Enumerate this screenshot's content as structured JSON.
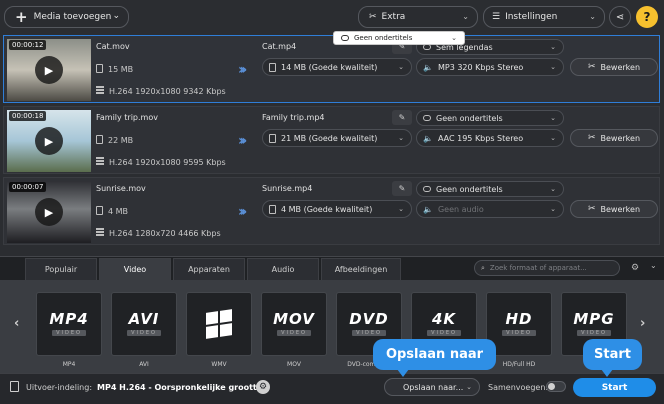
{
  "toolbar": {
    "add_media_label": "Media toevoegen",
    "extra_label": "Extra",
    "settings_label": "Instellingen",
    "help_label": "?"
  },
  "subtitle_tooltip": "Geen ondertitels",
  "files": [
    {
      "duration": "00:00:12",
      "name": "Cat.mov",
      "size": "15 MB",
      "codec": "H.264 1920x1080 9342 Kbps",
      "output_name": "Cat.mp4",
      "output_size": "14 MB (Goede kwaliteit)",
      "subtitles": "Sem legendas",
      "audio": "MP3 320 Kbps Stereo",
      "edit_label": "Bewerken"
    },
    {
      "duration": "00:00:18",
      "name": "Family trip.mov",
      "size": "22 MB",
      "codec": "H.264 1920x1080 9595 Kbps",
      "output_name": "Family trip.mp4",
      "output_size": "21 MB (Goede kwaliteit)",
      "subtitles": "Geen ondertitels",
      "audio": "AAC 195 Kbps Stereo",
      "edit_label": "Bewerken"
    },
    {
      "duration": "00:00:07",
      "name": "Sunrise.mov",
      "size": "4 MB",
      "codec": "H.264 1280x720 4466 Kbps",
      "output_name": "Sunrise.mp4",
      "output_size": "4 MB (Goede kwaliteit)",
      "subtitles": "Geen ondertitels",
      "audio": "Geen audio",
      "edit_label": "Bewerken"
    }
  ],
  "tabs": [
    "Populair",
    "Video",
    "Apparaten",
    "Audio",
    "Afbeeldingen"
  ],
  "active_tab": "Video",
  "format_search_placeholder": "Zoek formaat of apparaat...",
  "formats": [
    {
      "badge": "MP4",
      "label": "MP4"
    },
    {
      "badge": "AVI",
      "label": "AVI"
    },
    {
      "badge": "",
      "label": "WMV"
    },
    {
      "badge": "MOV",
      "label": "MOV"
    },
    {
      "badge": "DVD",
      "label": "DVD-compatib"
    },
    {
      "badge": "4K",
      "label": ""
    },
    {
      "badge": "HD",
      "label": "HD/Full HD"
    },
    {
      "badge": "MPG",
      "label": "MPG"
    }
  ],
  "format_tag": "VIDEO",
  "bottom": {
    "output_label": "Uitvoer-indeling:",
    "output_value": "MP4 H.264 - Oorspronkelijke grootte",
    "save_label": "Opslaan naar...",
    "merge_label": "Samenvoegen:",
    "start_label": "Start"
  },
  "callouts": {
    "save": "Opslaan naar",
    "start": "Start"
  },
  "colors": {
    "accent": "#1f8de8",
    "help": "#f6c02e",
    "selected_border": "#2f7ed8"
  }
}
